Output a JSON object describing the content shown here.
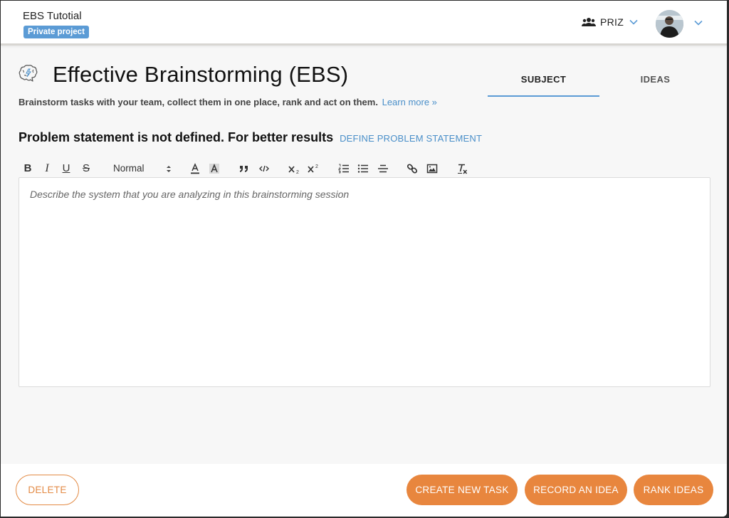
{
  "header": {
    "project_title": "EBS Tutotial",
    "badge": "Private project",
    "team_label": "PRIZ",
    "icons": {
      "team": "users-icon",
      "dropdown": "chevron-down-icon",
      "avatar": "user-avatar"
    }
  },
  "page": {
    "icon": "brain-icon",
    "title": "Effective Brainstorming (EBS)",
    "subtitle": "Brainstorm tasks with your team, collect them in one place, rank and act on them.",
    "learn_more": "Learn more »"
  },
  "tabs": [
    {
      "label": "SUBJECT",
      "active": true
    },
    {
      "label": "IDEAS",
      "active": false
    }
  ],
  "problem": {
    "text": "Problem statement is not defined. For better results",
    "link": "DEFINE PROBLEM STATEMENT"
  },
  "toolbar": {
    "bold": "B",
    "italic": "I",
    "underline": "U",
    "strike": "S",
    "heading_select": "Normal",
    "items": [
      "bold",
      "italic",
      "underline",
      "strikethrough",
      "heading",
      "font-color",
      "background-color",
      "blockquote",
      "code-block",
      "subscript",
      "superscript",
      "ordered-list",
      "bullet-list",
      "align",
      "link",
      "image",
      "clear-formatting"
    ]
  },
  "editor": {
    "value": "",
    "placeholder": "Describe the system that you are analyzing in this brainstorming session"
  },
  "footer": {
    "delete": "DELETE",
    "create_task": "CREATE NEW TASK",
    "record_idea": "RECORD AN IDEA",
    "rank_ideas": "RANK IDEAS"
  },
  "colors": {
    "accent_blue": "#5b9bd5",
    "link_blue": "#4a8fc9",
    "orange": "#e8863e"
  }
}
